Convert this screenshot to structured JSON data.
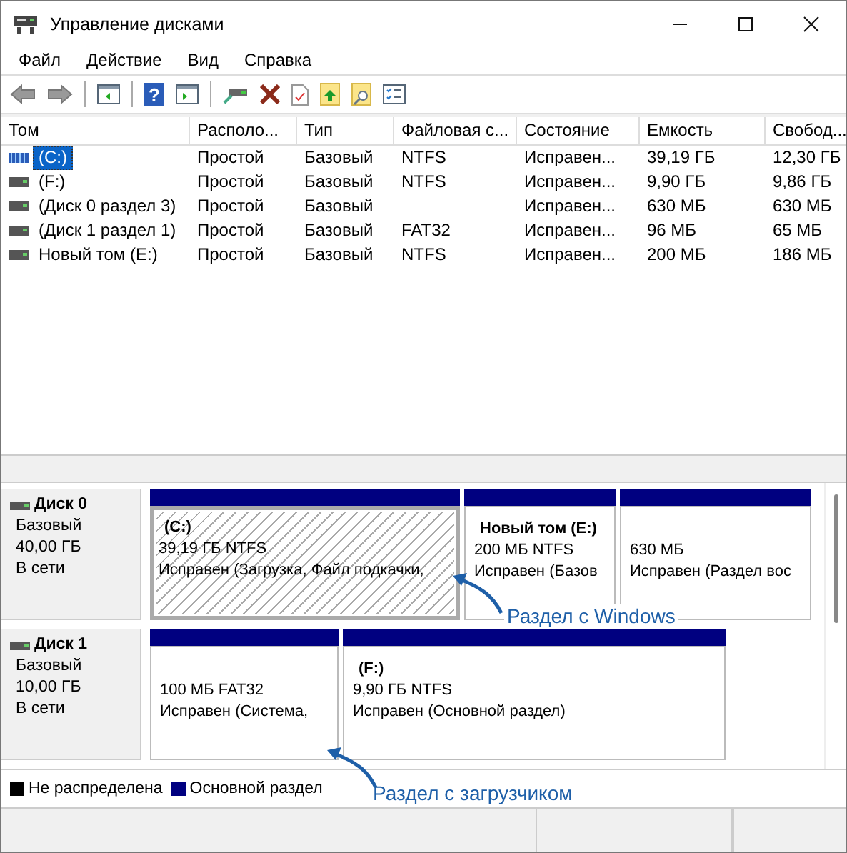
{
  "window": {
    "title": "Управление дисками"
  },
  "menu": [
    "Файл",
    "Действие",
    "Вид",
    "Справка"
  ],
  "toolbar": {
    "help_glyph": "?"
  },
  "table": {
    "columns": [
      "Том",
      "Располо...",
      "Тип",
      "Файловая с...",
      "Состояние",
      "Емкость",
      "Свобод..."
    ],
    "rows": [
      {
        "selected": true,
        "cells": [
          "(C:)",
          "Простой",
          "Базовый",
          "NTFS",
          "Исправен...",
          "39,19 ГБ",
          "12,30 ГБ"
        ]
      },
      {
        "selected": false,
        "cells": [
          "(F:)",
          "Простой",
          "Базовый",
          "NTFS",
          "Исправен...",
          "9,90 ГБ",
          "9,86 ГБ"
        ]
      },
      {
        "selected": false,
        "cells": [
          "(Диск 0 раздел 3)",
          "Простой",
          "Базовый",
          "",
          "Исправен...",
          "630 МБ",
          "630 МБ"
        ]
      },
      {
        "selected": false,
        "cells": [
          "(Диск 1 раздел 1)",
          "Простой",
          "Базовый",
          "FAT32",
          "Исправен...",
          "96 МБ",
          "65 МБ"
        ]
      },
      {
        "selected": false,
        "cells": [
          "Новый том (E:)",
          "Простой",
          "Базовый",
          "NTFS",
          "Исправен...",
          "200 МБ",
          "186 МБ"
        ]
      }
    ]
  },
  "disks": [
    {
      "name": "Диск 0",
      "type": "Базовый",
      "size": "40,00 ГБ",
      "state": "В сети",
      "partitions": [
        {
          "selected": true,
          "name": "(C:)",
          "size": "39,19 ГБ NTFS",
          "status": "Исправен (Загрузка, Файл подкачки,"
        },
        {
          "selected": false,
          "name": "Новый том  (E:)",
          "size": "200 МБ NTFS",
          "status": "Исправен (Базов"
        },
        {
          "selected": false,
          "size": "630 МБ",
          "status": "Исправен (Раздел вос"
        }
      ]
    },
    {
      "name": "Диск 1",
      "type": "Базовый",
      "size": "10,00 ГБ",
      "state": "В сети",
      "partitions": [
        {
          "selected": false,
          "size": "100 МБ FAT32",
          "status": "Исправен (Система,"
        },
        {
          "selected": false,
          "name": "(F:)",
          "size": "9,90 ГБ NTFS",
          "status": "Исправен (Основной раздел)"
        }
      ]
    }
  ],
  "legend": [
    {
      "label": "Не распределена",
      "color": "#000000"
    },
    {
      "label": "Основной раздел",
      "color": "#000080"
    }
  ],
  "annotations": [
    "Раздел с Windows",
    "Раздел с загрузчиком"
  ]
}
